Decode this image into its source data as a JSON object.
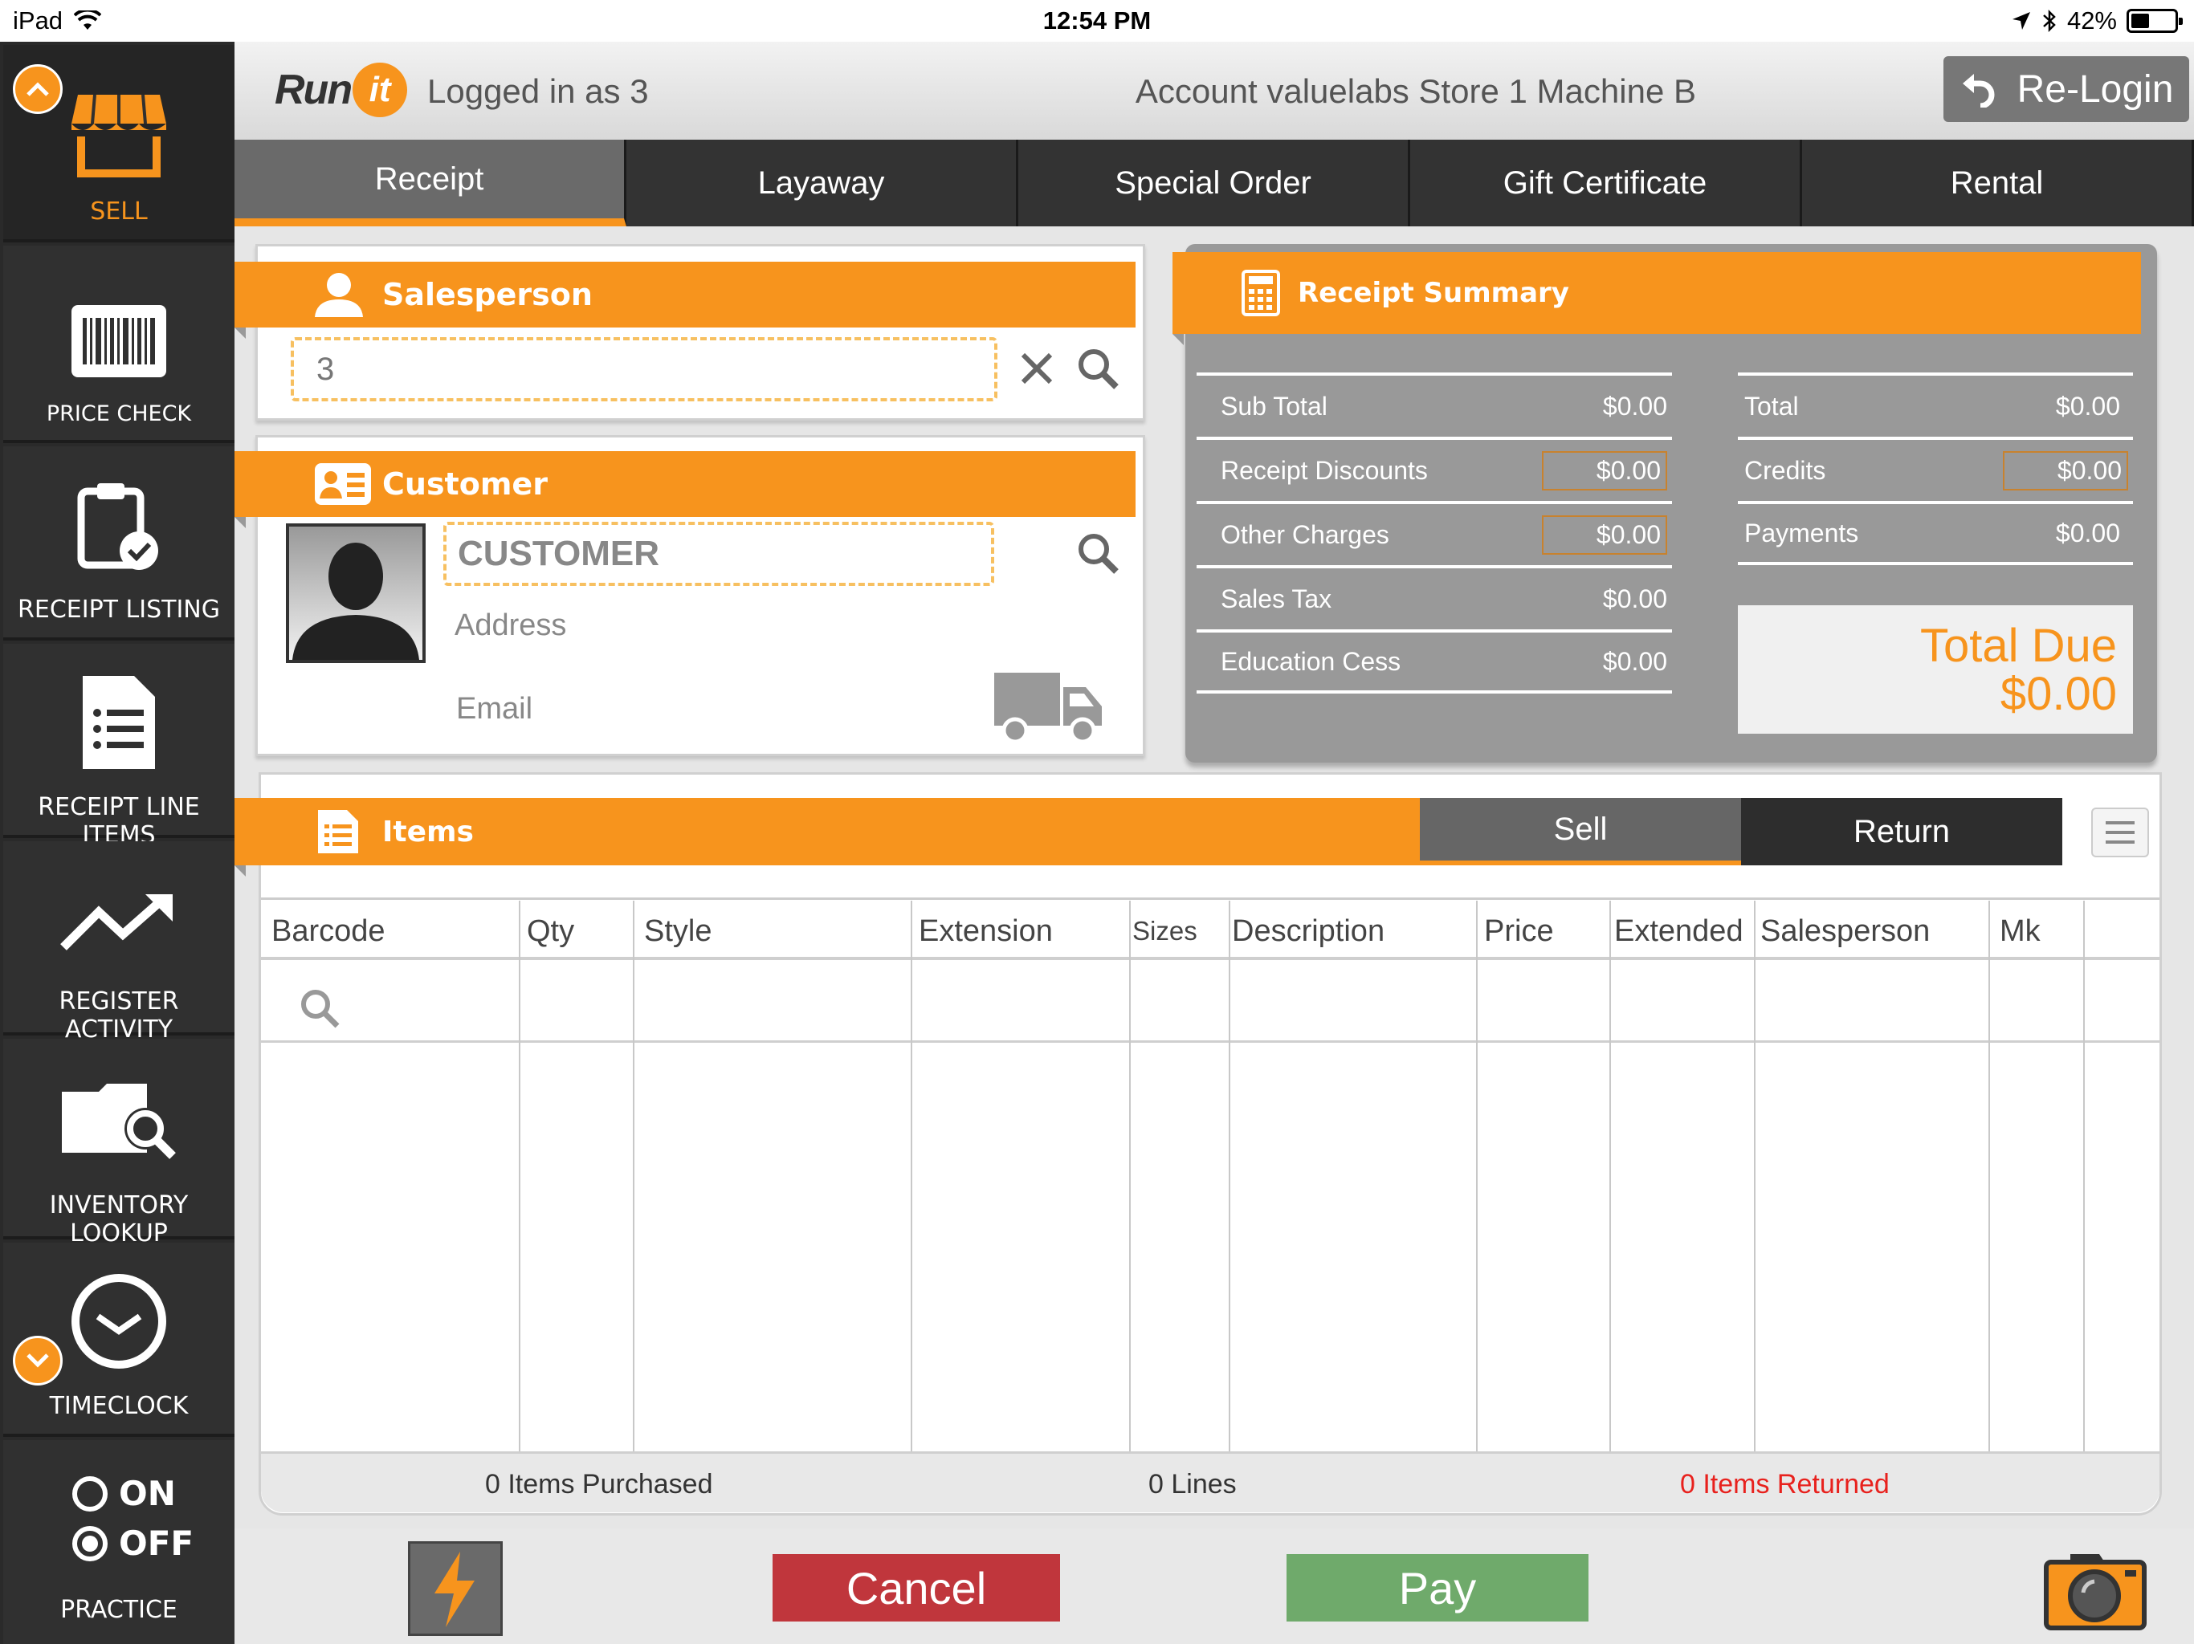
{
  "status_bar": {
    "device": "iPad",
    "time": "12:54 PM",
    "battery": "42%"
  },
  "sidebar": {
    "items": [
      {
        "label": "SELL",
        "icon": "store-icon"
      },
      {
        "label": "PRICE CHECK",
        "icon": "barcode-icon"
      },
      {
        "label": "RECEIPT LISTING",
        "icon": "clipboard-check-icon"
      },
      {
        "label": "RECEIPT LINE ITEMS",
        "icon": "document-list-icon"
      },
      {
        "label": "REGISTER ACTIVITY",
        "icon": "trend-up-icon"
      },
      {
        "label": "INVENTORY LOOKUP",
        "icon": "folder-search-icon"
      },
      {
        "label": "TIMECLOCK",
        "icon": "clock-icon"
      },
      {
        "label": "PRACTICE",
        "icon": "toggle-icon"
      }
    ],
    "practice_on": "ON",
    "practice_off": "OFF"
  },
  "header": {
    "logo_run": "Run",
    "logo_it": "it",
    "logged_in": "Logged in as 3",
    "account": "Account valuelabs Store 1 Machine B",
    "relogin_label": "Re-Login"
  },
  "tabs": [
    {
      "label": "Receipt",
      "active": true
    },
    {
      "label": "Layaway",
      "active": false
    },
    {
      "label": "Special Order",
      "active": false
    },
    {
      "label": "Gift Certificate",
      "active": false
    },
    {
      "label": "Rental",
      "active": false
    }
  ],
  "salesperson": {
    "title": "Salesperson",
    "value": "3"
  },
  "customer": {
    "title": "Customer",
    "placeholder": "CUSTOMER",
    "address": "Address",
    "email": "Email"
  },
  "summary": {
    "title": "Receipt Summary",
    "left_rows": [
      {
        "label": "Sub Total",
        "value": "$0.00"
      },
      {
        "label": "Receipt Discounts",
        "value": "$0.00"
      },
      {
        "label": "Other Charges",
        "value": "$0.00"
      },
      {
        "label": "Sales Tax",
        "value": "$0.00"
      },
      {
        "label": "Education Cess",
        "value": "$0.00"
      }
    ],
    "right_rows": [
      {
        "label": "Total",
        "value": "$0.00"
      },
      {
        "label": "Credits",
        "value": "$0.00"
      },
      {
        "label": "Payments",
        "value": "$0.00"
      }
    ],
    "total_due_label": "Total Due",
    "total_due_value": "$0.00"
  },
  "items": {
    "title": "Items",
    "sell_label": "Sell",
    "return_label": "Return",
    "columns": [
      "Barcode",
      "Qty",
      "Style",
      "Extension",
      "Sizes",
      "Description",
      "Price",
      "Extended",
      "Salesperson",
      "Mk"
    ],
    "purchased": "0 Items Purchased",
    "lines": "0 Lines",
    "returned": "0 Items Returned"
  },
  "actions": {
    "cancel_label": "Cancel",
    "pay_label": "Pay"
  },
  "colors": {
    "accent": "#f7941d",
    "cancel": "#c0363c",
    "pay": "#6faa6b",
    "returned_text": "#e8211d"
  }
}
